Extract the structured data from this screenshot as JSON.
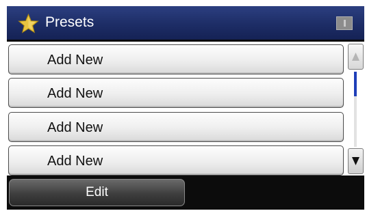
{
  "header": {
    "title": "Presets",
    "icon": "star-icon",
    "status_icon": "wifi-status-icon",
    "colors": {
      "bar": "#1d2d66",
      "star": "#e8c441"
    }
  },
  "presets": {
    "items": [
      {
        "label": "Add New"
      },
      {
        "label": "Add New"
      },
      {
        "label": "Add New"
      },
      {
        "label": "Add New"
      }
    ]
  },
  "scrollbar": {
    "up_icon": "triangle-up-icon",
    "down_icon": "triangle-down-icon",
    "position": 0
  },
  "footer": {
    "edit_label": "Edit"
  }
}
